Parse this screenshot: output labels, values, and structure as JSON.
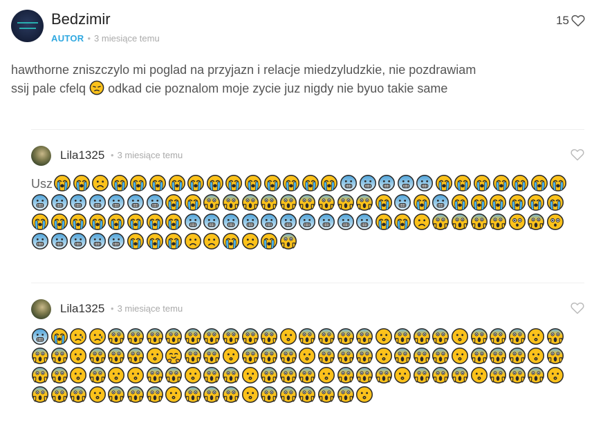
{
  "main_comment": {
    "author": "Bedzimir",
    "badge": "AUTOR",
    "time": "3 miesiące temu",
    "likes": "15",
    "text_line1": "hawthorne zniszczylo mi poglad na przyjazn i relacje miedzyludzkie, nie pozdrawiam",
    "text_line2_a": "ssij pale cfelq",
    "text_line2_emoji": "pensive",
    "text_line2_b": "odkad cie poznalom moje zycie juz nigdy nie byuo takie same"
  },
  "replies": [
    {
      "author": "Lila1325",
      "time": "3 miesiące temu",
      "lead_text": "Usz",
      "emojis": [
        "cry",
        "cry",
        "frown",
        "cry",
        "cry",
        "cry",
        "cry",
        "cry",
        "cry",
        "cry",
        "cry",
        "cry",
        "cry",
        "cry",
        "cry",
        "fear",
        "fear",
        "fear",
        "fear",
        "fear",
        "cry",
        "cry",
        "cry",
        "cry",
        "cry",
        "cry",
        "cry",
        "fear",
        "fear",
        "fear",
        "fear",
        "fear",
        "fear",
        "fear",
        "cry",
        "cry",
        "scream",
        "scream",
        "scream",
        "scream",
        "scream",
        "scream",
        "scream",
        "scream",
        "scream",
        "cry",
        "fear",
        "cry",
        "fear",
        "cry",
        "cry",
        "cry",
        "cry",
        "cry",
        "cry",
        "cry",
        "cry",
        "cry",
        "cry",
        "cry",
        "cry",
        "cry",
        "cry",
        "fear",
        "fear",
        "fear",
        "fear",
        "fear",
        "fear",
        "fear",
        "fear",
        "fear",
        "fear",
        "cry",
        "cry",
        "frown",
        "scream",
        "scream",
        "scream",
        "scream",
        "astonished",
        "scream",
        "astonished",
        "fear",
        "fear",
        "fear",
        "fear",
        "fear",
        "cry",
        "cry",
        "cry",
        "frown",
        "frown",
        "cry",
        "frown",
        "cry",
        "scream"
      ]
    },
    {
      "author": "Lila1325",
      "time": "3 miesiące temu",
      "lead_text": "",
      "emojis": [
        "fear",
        "cry",
        "sad",
        "sad",
        "scream",
        "scream",
        "scream",
        "scream",
        "scream",
        "scream",
        "scream",
        "scream",
        "scream",
        "hushed",
        "scream",
        "scream",
        "scream",
        "scream",
        "hushed",
        "scream",
        "scream",
        "scream",
        "hushed",
        "scream",
        "scream",
        "scream",
        "hushed",
        "scream",
        "scream",
        "scream",
        "hushed",
        "scream",
        "scream",
        "scream",
        "hushed",
        "hug",
        "scream",
        "scream",
        "hushed",
        "scream",
        "scream",
        "scream",
        "hushed",
        "scream",
        "scream",
        "scream",
        "hushed",
        "scream",
        "scream",
        "scream",
        "hushed",
        "scream",
        "scream",
        "scream",
        "hushed",
        "scream",
        "scream",
        "scream",
        "hushed",
        "scream",
        "hushed",
        "hushed",
        "scream",
        "scream",
        "hushed",
        "scream",
        "scream",
        "hushed",
        "scream",
        "scream",
        "scream",
        "hushed",
        "scream",
        "scream",
        "scream",
        "hushed",
        "scream",
        "scream",
        "scream",
        "hushed",
        "scream",
        "scream",
        "scream",
        "hushed",
        "scream",
        "scream",
        "scream",
        "hushed",
        "scream",
        "scream",
        "scream",
        "hushed",
        "scream",
        "scream",
        "scream",
        "hushed",
        "scream",
        "scream",
        "scream",
        "scream",
        "scream",
        "hushed"
      ]
    }
  ]
}
